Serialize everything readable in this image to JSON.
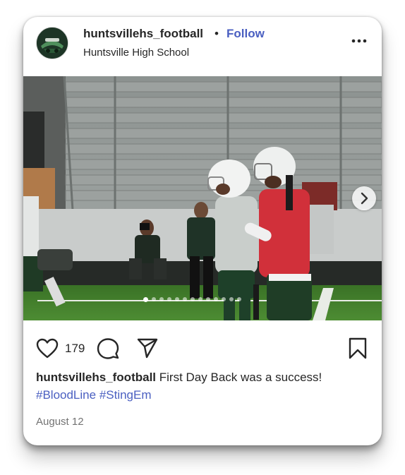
{
  "post": {
    "username": "huntsvillehs_football",
    "separator": "•",
    "follow_label": "Follow",
    "location": "Huntsville High School",
    "likes": "179",
    "caption_user": "huntsvillehs_football",
    "caption_text": "First Day Back was a success!",
    "hashtags": [
      "#BloodLine",
      "#StingEm"
    ],
    "date": "August 12",
    "carousel": {
      "slide_count": 13,
      "active_index": 0
    }
  },
  "icons": {
    "avatar": "team-logo",
    "more": "more-options-icon",
    "next": "chevron-right-icon",
    "like": "heart-icon",
    "comment": "comment-bubble-icon",
    "share": "paper-plane-icon",
    "save": "bookmark-icon"
  },
  "colors": {
    "link": "#4a5fc1",
    "text": "#262626",
    "muted": "#737373",
    "field": "#3f7a2a"
  }
}
